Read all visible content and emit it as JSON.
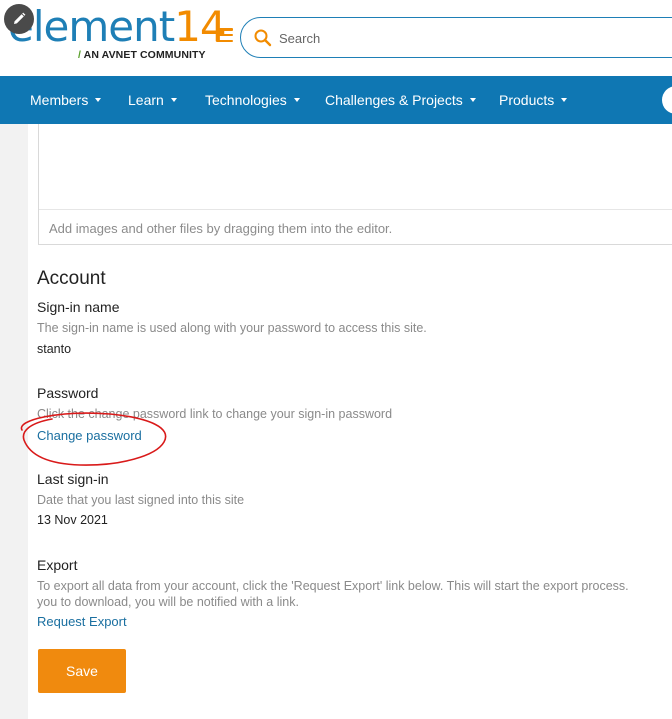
{
  "header": {
    "logo_text": "element",
    "logo_number": "14",
    "logo_slash": "/",
    "logo_tagline": "AN AVNET COMMUNITY",
    "search_placeholder": "Search"
  },
  "nav": {
    "items": [
      {
        "label": "Members"
      },
      {
        "label": "Learn"
      },
      {
        "label": "Technologies"
      },
      {
        "label": "Challenges & Projects"
      },
      {
        "label": "Products"
      }
    ]
  },
  "editor": {
    "hint": "Add images and other files by dragging them into the editor."
  },
  "account": {
    "title": "Account",
    "signin": {
      "label": "Sign-in name",
      "description": "The sign-in name is used along with your password to access this site.",
      "value": "stanto"
    },
    "password": {
      "label": "Password",
      "description": "Click the change password link to change your sign-in password",
      "link": "Change password"
    },
    "last_signin": {
      "label": "Last sign-in",
      "description": "Date that you last signed into this site",
      "value": "13 Nov 2021"
    },
    "export": {
      "label": "Export",
      "description_line1": "To export all data from your account, click the 'Request Export' link below. This will start the export process.",
      "description_line2": "you to download, you will be notified with a link.",
      "link": "Request Export"
    },
    "save_label": "Save"
  },
  "colors": {
    "brand_blue": "#0f77b3",
    "brand_orange": "#f28b00",
    "annotation_red": "#d91a1a"
  }
}
